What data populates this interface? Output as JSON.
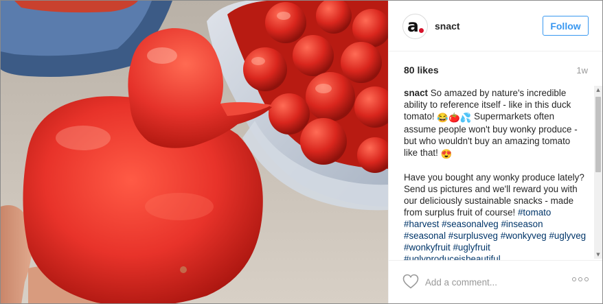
{
  "post": {
    "username": "snact",
    "follow_label": "Follow",
    "likes": "80 likes",
    "age": "1w",
    "caption_user": "snact",
    "caption_text_1": " So amazed by nature's incredible ability to reference itself - like in this duck tomato! ",
    "caption_text_2": " Supermarkets often assume people won't buy wonky produce - but who wouldn't buy an amazing tomato like that! ",
    "caption_text_3": "Have you bought any wonky produce lately? Send us pictures and we'll reward you with our deliciously sustainable snacks - made from surplus fruit of course! ",
    "hashtags": [
      "#tomato",
      "#harvest",
      "#seasonalveg",
      "#inseason",
      "#seasonal",
      "#surplusveg",
      "#wonkyveg",
      "#uglyveg",
      "#wonkyfruit",
      "#uglyfruit",
      "#uglyproduceisbeautiful"
    ],
    "emoji_1": [
      "😂",
      "🍅",
      "💦"
    ],
    "emoji_2": "😍",
    "comment_placeholder": "Add a comment...",
    "avatar_mark": "a"
  },
  "icons": {
    "heart": "heart-icon",
    "more": "more-options-icon",
    "scroll_up": "▲",
    "scroll_down": "▼"
  },
  "colors": {
    "accent": "#3897f0",
    "hashtag": "#003569",
    "avatar_dot": "#d6132b",
    "tomato": "#e8332a"
  }
}
